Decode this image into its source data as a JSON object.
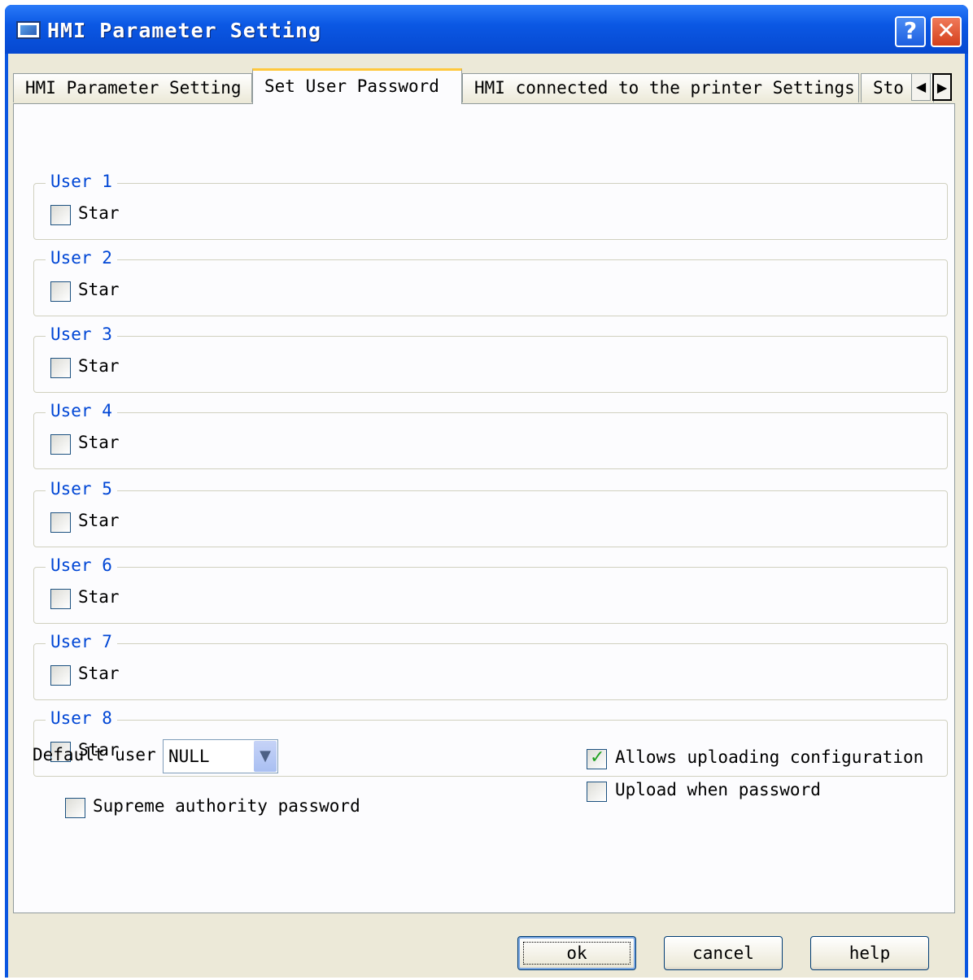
{
  "window": {
    "title": "HMI Parameter Setting",
    "help_glyph": "?",
    "close_glyph": "✕"
  },
  "tabs": [
    {
      "label": "HMI Parameter Setting",
      "active": false
    },
    {
      "label": "Set User Password",
      "active": true
    },
    {
      "label": "HMI connected to the printer Settings",
      "active": false
    },
    {
      "label": "Sto",
      "active": false
    }
  ],
  "tab_scroll": {
    "left": "◀",
    "right": "▶"
  },
  "users": [
    {
      "legend": "User 1",
      "checkbox_label": "Star",
      "checked": false
    },
    {
      "legend": "User 2",
      "checkbox_label": "Star",
      "checked": false
    },
    {
      "legend": "User 3",
      "checkbox_label": "Star",
      "checked": false
    },
    {
      "legend": "User 4",
      "checkbox_label": "Star",
      "checked": false
    },
    {
      "legend": "User 5",
      "checkbox_label": "Star",
      "checked": false
    },
    {
      "legend": "User 6",
      "checkbox_label": "Star",
      "checked": false
    },
    {
      "legend": "User 7",
      "checkbox_label": "Star",
      "checked": false
    },
    {
      "legend": "User 8",
      "checkbox_label": "Star",
      "checked": false
    }
  ],
  "default_user": {
    "label": "Default user I",
    "value": "NULL"
  },
  "supreme": {
    "label": "Supreme authority password",
    "checked": false
  },
  "allow_upload": {
    "label": "Allows uploading configuration",
    "checked": true
  },
  "upload_password": {
    "label": "Upload when password",
    "checked": false
  },
  "buttons": {
    "ok": "ok",
    "cancel": "cancel",
    "help": "help"
  },
  "colors": {
    "title_bar": "#0b58e4",
    "legend_text": "#0046d5",
    "tab_highlight": "#ffc83c",
    "client_bg": "#ece9d8"
  }
}
